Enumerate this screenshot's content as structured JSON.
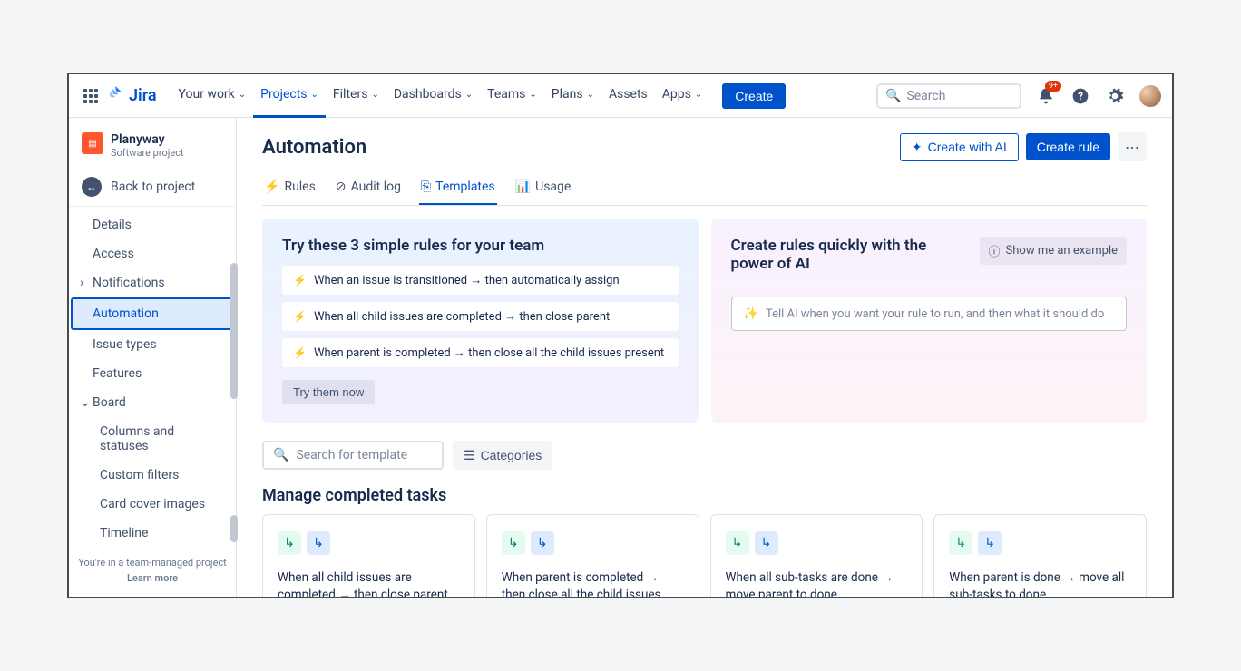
{
  "top": {
    "product": "Jira",
    "nav": [
      "Your work",
      "Projects",
      "Filters",
      "Dashboards",
      "Teams",
      "Plans",
      "Assets",
      "Apps"
    ],
    "active_nav_index": 1,
    "create": "Create",
    "search_placeholder": "Search",
    "notif_badge": "9+"
  },
  "sidebar": {
    "project_name": "Planyway",
    "project_type": "Software project",
    "back": "Back to project",
    "items": [
      {
        "label": "Details"
      },
      {
        "label": "Access"
      },
      {
        "label": "Notifications",
        "expand": "right"
      },
      {
        "label": "Automation",
        "selected": true
      },
      {
        "label": "Issue types"
      },
      {
        "label": "Features"
      },
      {
        "label": "Board",
        "expand": "down"
      },
      {
        "label": "Columns and statuses",
        "child": true
      },
      {
        "label": "Custom filters",
        "child": true
      },
      {
        "label": "Card cover images",
        "child": true
      },
      {
        "label": "Timeline",
        "child": true
      }
    ],
    "footer1": "You're in a team-managed project",
    "footer2": "Learn more"
  },
  "page": {
    "title": "Automation",
    "create_ai": "Create with AI",
    "create_rule": "Create rule",
    "tabs": [
      "Rules",
      "Audit log",
      "Templates",
      "Usage"
    ],
    "active_tab_index": 2
  },
  "try_panel": {
    "heading": "Try these 3 simple rules for your team",
    "rules": [
      "When an issue is transitioned → then automatically assign",
      "When all child issues are completed → then close parent",
      "When parent is completed → then close all the child issues present"
    ],
    "cta": "Try them now"
  },
  "ai_panel": {
    "heading": "Create rules quickly with the power of AI",
    "show_example": "Show me an example",
    "placeholder": "Tell AI when you want your rule to run, and then what it should do"
  },
  "filters": {
    "search_placeholder": "Search for template",
    "categories": "Categories"
  },
  "section": {
    "heading": "Manage completed tasks",
    "cards": [
      "When all child issues are completed → then close parent",
      "When parent is completed → then close all the child issues present",
      "When all sub-tasks are done → move parent to done",
      "When parent is done → move all sub-tasks to done"
    ]
  }
}
